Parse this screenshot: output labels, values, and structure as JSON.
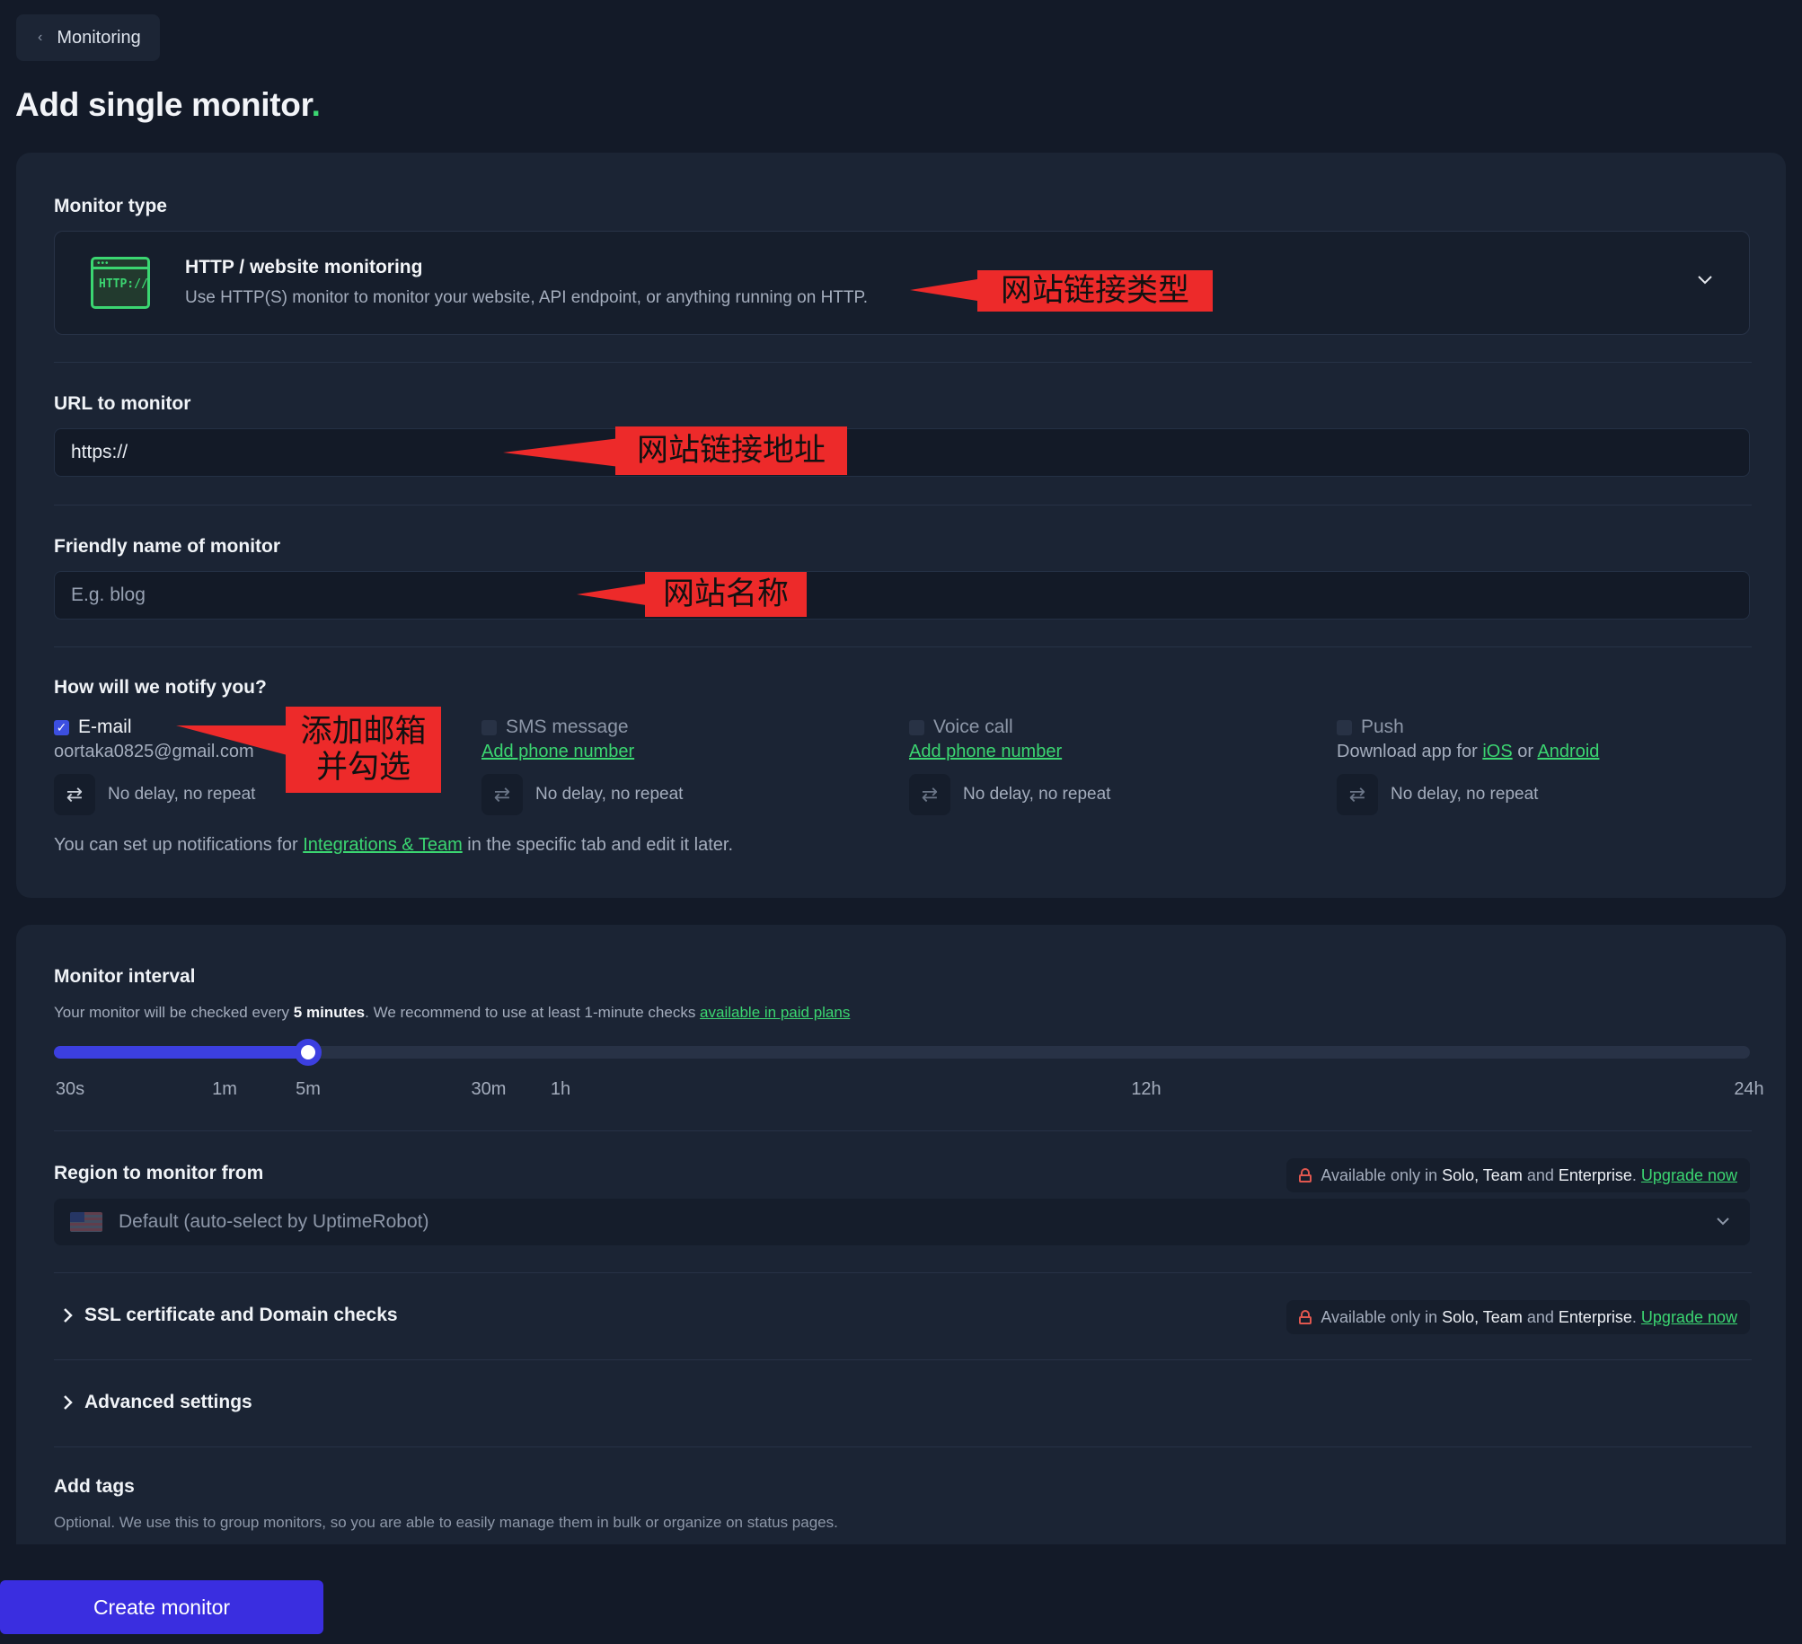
{
  "nav": {
    "back_label": "Monitoring"
  },
  "page": {
    "title": "Add single monitor",
    "title_dot": "."
  },
  "monitor_type": {
    "label": "Monitor type",
    "selected_title": "HTTP / website monitoring",
    "selected_desc": "Use HTTP(S) monitor to monitor your website, API endpoint, or anything running on HTTP.",
    "icon_text": "HTTP://"
  },
  "url": {
    "label": "URL to monitor",
    "value": "https://"
  },
  "friendly_name": {
    "label": "Friendly name of monitor",
    "placeholder": "E.g. blog"
  },
  "notify": {
    "label": "How will we notify you?",
    "email": {
      "label": "E-mail",
      "address": "oortaka0825@gmail.com",
      "repeat": "No delay, no repeat"
    },
    "sms": {
      "label": "SMS message",
      "link": "Add phone number",
      "repeat": "No delay, no repeat"
    },
    "voice": {
      "label": "Voice call",
      "link": "Add phone number",
      "repeat": "No delay, no repeat"
    },
    "push": {
      "label": "Push",
      "sub_prefix": "Download app for ",
      "ios": "iOS",
      "or": " or ",
      "android": "Android",
      "repeat": "No delay, no repeat"
    },
    "helper_prefix": "You can set up notifications for ",
    "helper_link": "Integrations & Team",
    "helper_suffix": " in the specific tab and edit it later."
  },
  "interval": {
    "label": "Monitor interval",
    "text_prefix": "Your monitor will be checked every ",
    "text_bold": "5 minutes",
    "text_mid": ". We recommend to use at least 1-minute checks ",
    "text_link": "available in paid plans",
    "ticks": [
      "30s",
      "1m",
      "5m",
      "30m",
      "1h",
      "12h",
      "24h"
    ],
    "selected": "5m",
    "fill_fraction": 0.15
  },
  "region": {
    "label": "Region to monitor from",
    "value": "Default (auto-select by UptimeRobot)",
    "badge_prefix": "Available only in ",
    "badge_plan1": "Solo, Team",
    "badge_and": " and ",
    "badge_plan2": "Enterprise",
    "badge_dot": ". ",
    "badge_link": "Upgrade now"
  },
  "ssl": {
    "label": "SSL certificate and Domain checks",
    "badge_prefix": "Available only in ",
    "badge_plan1": "Solo, Team",
    "badge_and": " and ",
    "badge_plan2": "Enterprise",
    "badge_dot": ". ",
    "badge_link": "Upgrade now"
  },
  "advanced": {
    "label": "Advanced settings"
  },
  "tags": {
    "label": "Add tags",
    "sub": "Optional. We use this to group monitors, so you are able to easily manage them in bulk or organize on status pages."
  },
  "create_button": "Create monitor",
  "annotations": {
    "type": "网站链接类型",
    "url": "网站链接地址",
    "name": "网站名称",
    "email_line1": "添加邮箱",
    "email_line2": "并勾选"
  },
  "colors": {
    "accent_green": "#3bd671",
    "accent_blue": "#3c3fe0",
    "annotation_red": "#ed2a2a"
  }
}
